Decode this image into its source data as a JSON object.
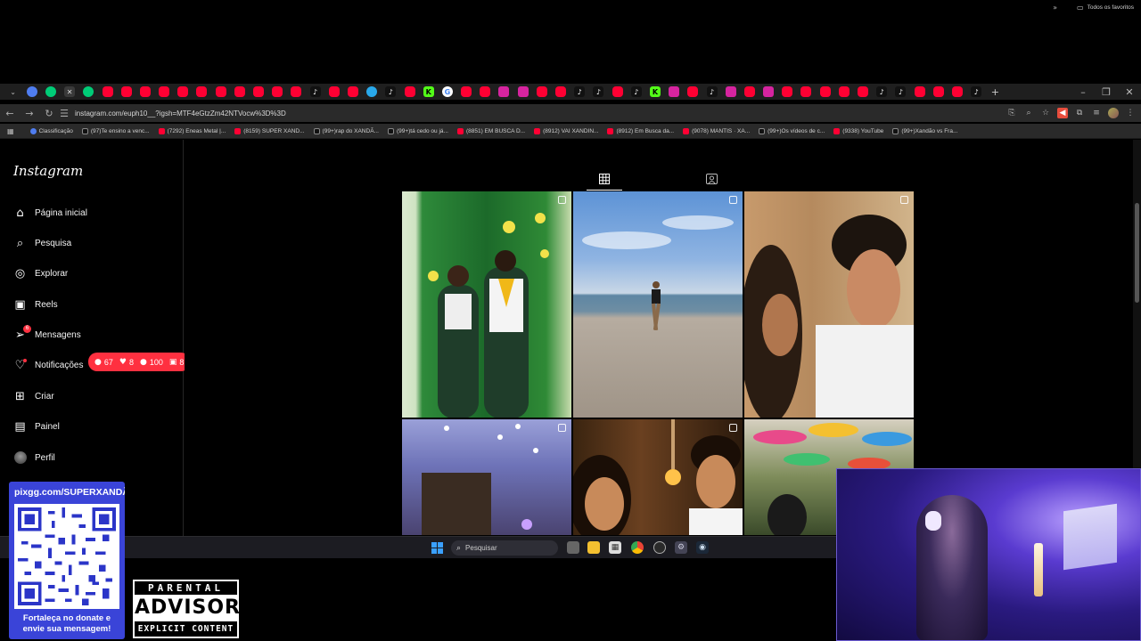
{
  "browser": {
    "url": "instagram.com/euph10__?igsh=MTF4eGtzZm42NTVocw%3D%3D",
    "tab_icons": [
      "bl",
      "gr",
      "active",
      "gr",
      "yt",
      "yt",
      "yt",
      "yt",
      "yt",
      "yt",
      "yt",
      "yt",
      "yt",
      "yt",
      "yt",
      "tt",
      "yt",
      "yt",
      "tg",
      "tt",
      "yt",
      "kk",
      "g",
      "yt",
      "yt",
      "ig",
      "ig",
      "yt",
      "yt",
      "tt",
      "tt",
      "yt",
      "tt",
      "kk",
      "ig",
      "yt",
      "tt",
      "ig",
      "yt",
      "ig",
      "yt",
      "yt",
      "yt",
      "yt",
      "yt",
      "tt",
      "tt",
      "yt",
      "yt",
      "yt",
      "tt"
    ],
    "bookmarks": [
      {
        "icon": "blue",
        "label": "Classificação"
      },
      {
        "icon": "tt",
        "label": "(97)Te ensino a venc..."
      },
      {
        "icon": "yt",
        "label": "(7292) Eneas Metal |..."
      },
      {
        "icon": "yt",
        "label": "(8159) SUPER XAND..."
      },
      {
        "icon": "tt",
        "label": "(99+)rap do XANDÃ..."
      },
      {
        "icon": "tt",
        "label": "(99+)tá cedo ou já..."
      },
      {
        "icon": "yt",
        "label": "(8851) EM BUSCA D..."
      },
      {
        "icon": "yt",
        "label": "(8912) VAI XANDIN..."
      },
      {
        "icon": "yt",
        "label": "(8912) Em Busca da..."
      },
      {
        "icon": "yt",
        "label": "(9078) MANTIS · XA..."
      },
      {
        "icon": "tt",
        "label": "(99+)Os vídeos de c..."
      },
      {
        "icon": "yt",
        "label": "(9338) YouTube"
      },
      {
        "icon": "tt",
        "label": "(99+)Xandão vs Fra..."
      }
    ],
    "favorites_label": "Todos os favoritos"
  },
  "instagram": {
    "logo": "Instagram",
    "nav": [
      {
        "key": "home",
        "icon": "home-icon",
        "label": "Página inicial"
      },
      {
        "key": "search",
        "icon": "search-icon",
        "label": "Pesquisa"
      },
      {
        "key": "explore",
        "icon": "compass-icon",
        "label": "Explorar"
      },
      {
        "key": "reels",
        "icon": "reels-icon",
        "label": "Reels"
      },
      {
        "key": "messages",
        "icon": "messenger-icon",
        "label": "Mensagens"
      },
      {
        "key": "notifications",
        "icon": "heart-icon",
        "label": "Notificações"
      },
      {
        "key": "create",
        "icon": "plus-square-icon",
        "label": "Criar"
      },
      {
        "key": "dashboard",
        "icon": "chart-icon",
        "label": "Painel"
      },
      {
        "key": "profile",
        "icon": "avatar",
        "label": "Perfil"
      }
    ],
    "messages_badge": "6",
    "notification_pill": {
      "comments": "67",
      "likes": "8",
      "follows": "100",
      "tags": "8"
    },
    "profile_tabs": [
      "grid-icon",
      "tagged-icon"
    ]
  },
  "taskbar": {
    "search_placeholder": "Pesquisar"
  },
  "overlay": {
    "donate_url": "pixgg.com/SUPERXANDÃO",
    "donate_text_line1": "Fortaleça no donate e",
    "donate_text_line2": "envie sua mensagem!",
    "advisory_top": "PARENTAL",
    "advisory_mid": "ADVISORY",
    "advisory_bot": "EXPLICIT CONTENT"
  }
}
